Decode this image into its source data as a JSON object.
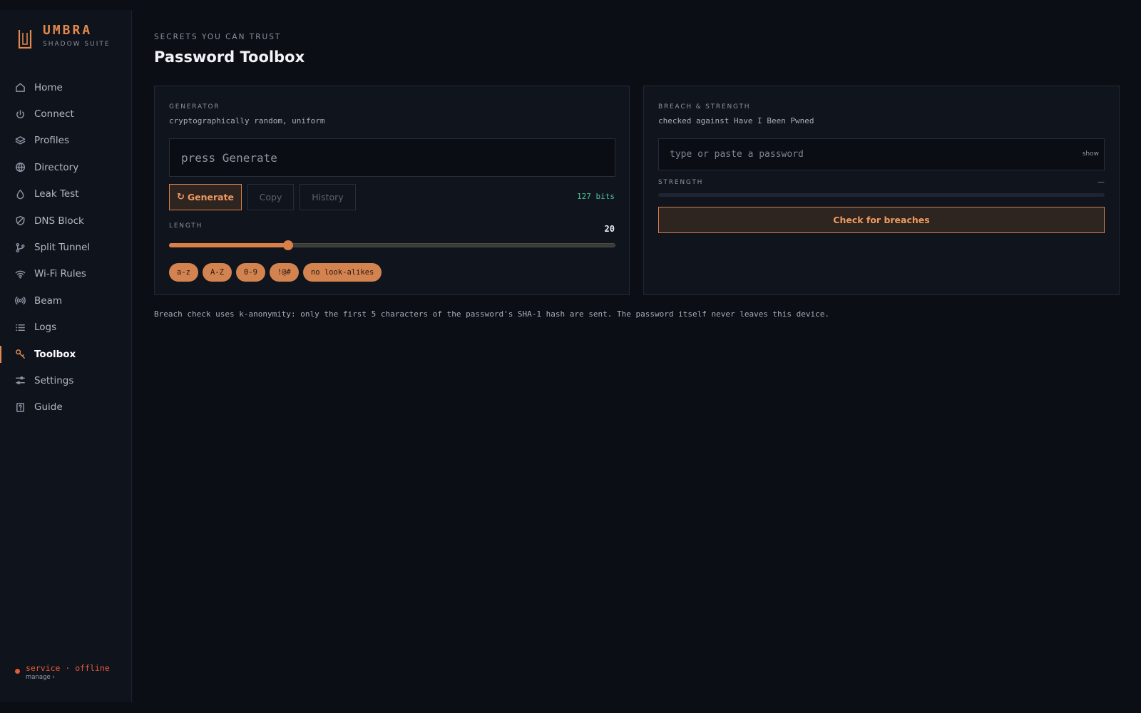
{
  "brand": {
    "name": "UMBRA",
    "subtitle": "SHADOW SUITE"
  },
  "sidebar": {
    "items": [
      {
        "label": "Home",
        "icon": "home-icon"
      },
      {
        "label": "Connect",
        "icon": "power-icon"
      },
      {
        "label": "Profiles",
        "icon": "layers-icon"
      },
      {
        "label": "Directory",
        "icon": "globe-icon"
      },
      {
        "label": "Leak Test",
        "icon": "droplet-icon"
      },
      {
        "label": "DNS Block",
        "icon": "shield-icon"
      },
      {
        "label": "Split Tunnel",
        "icon": "git-branch-icon"
      },
      {
        "label": "Wi-Fi Rules",
        "icon": "wifi-icon"
      },
      {
        "label": "Beam",
        "icon": "broadcast-icon"
      },
      {
        "label": "Logs",
        "icon": "list-icon"
      },
      {
        "label": "Toolbox",
        "icon": "key-icon",
        "active": true
      },
      {
        "label": "Settings",
        "icon": "sliders-icon"
      },
      {
        "label": "Guide",
        "icon": "book-icon"
      }
    ],
    "service": {
      "status": "service · offline",
      "manage": "manage ›",
      "status_color": "#e25a3a"
    }
  },
  "header": {
    "eyebrow": "SECRETS YOU CAN TRUST",
    "title": "Password Toolbox"
  },
  "generator": {
    "label": "GENERATOR",
    "subtitle": "cryptographically random, uniform",
    "output_placeholder": "press Generate",
    "buttons": {
      "generate": "Generate",
      "copy": "Copy",
      "history": "History"
    },
    "bits": "127 bits",
    "length_label": "LENGTH",
    "length_value": "20",
    "length_min": 4,
    "length_max": 64,
    "chips": [
      "a-z",
      "A-Z",
      "0-9",
      "!@#",
      "no look-alikes"
    ]
  },
  "breach": {
    "label": "BREACH & STRENGTH",
    "subtitle": "checked against Have I Been Pwned",
    "input_placeholder": "type or paste a password",
    "show_label": "show",
    "strength_label": "STRENGTH",
    "strength_value": "—",
    "check_label": "Check for breaches"
  },
  "note": "Breach check uses k-anonymity: only the first 5 characters of the password's SHA-1 hash are sent. The password itself never leaves this device.",
  "colors": {
    "accent": "#e0894f",
    "background": "#0b0e14",
    "panel": "#10141d",
    "success": "#4fc39a"
  }
}
